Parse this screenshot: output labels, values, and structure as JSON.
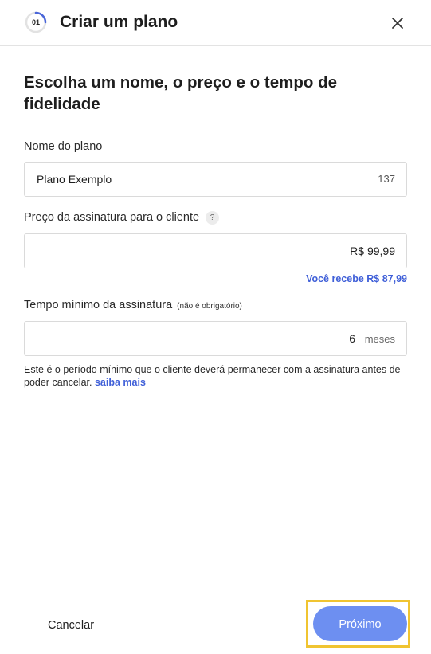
{
  "header": {
    "step_number": "01",
    "title": "Criar um plano",
    "close_icon": "close-icon"
  },
  "heading": "Escolha um nome, o preço e o tempo de fidelidade",
  "plan_name": {
    "label": "Nome do plano",
    "value": "Plano Exemplo",
    "char_counter": "137"
  },
  "price": {
    "label": "Preço da assinatura para o cliente",
    "help_icon": "?",
    "value": "R$ 99,99",
    "you_receive": "Você recebe R$ 87,99"
  },
  "min_time": {
    "label": "Tempo mínimo da assinatura",
    "optional_note": "(não é obrigatório)",
    "value": "6",
    "unit": "meses",
    "hint": "Este é o período mínimo que o cliente deverá permanecer com a assinatura antes de poder cancelar.",
    "learn_more": "saiba mais"
  },
  "footer": {
    "cancel_label": "Cancelar",
    "next_label": "Próximo"
  },
  "colors": {
    "accent": "#3f5fd8",
    "primary_button": "#6d8ff1",
    "highlight_border": "#f0c431"
  }
}
